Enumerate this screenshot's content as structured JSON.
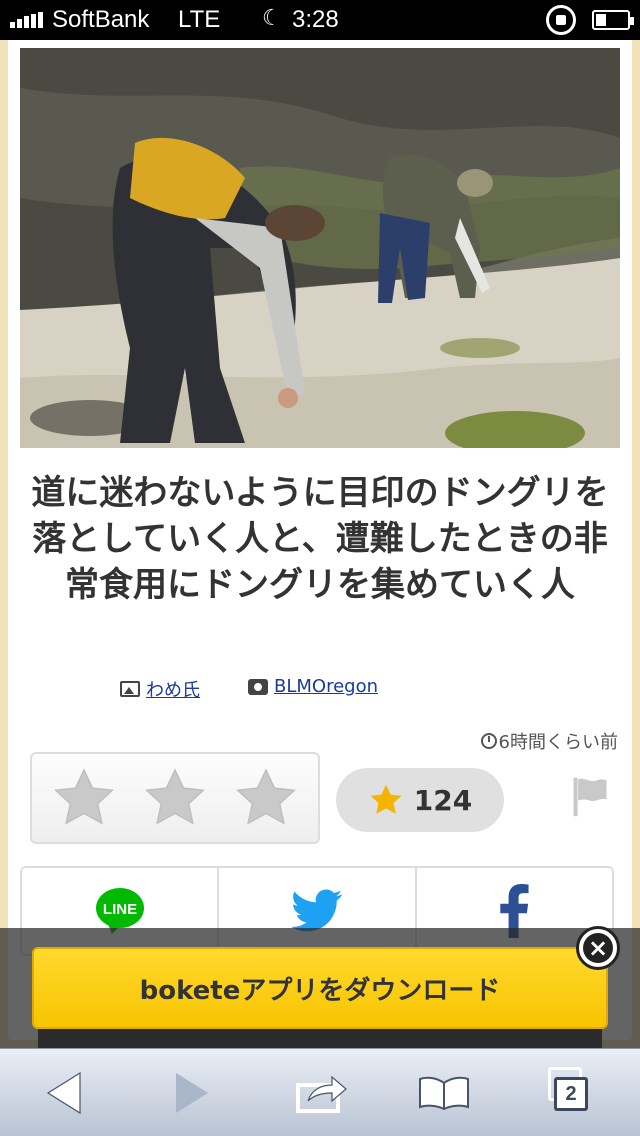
{
  "status_bar": {
    "carrier": "SoftBank",
    "network": "LTE",
    "time": "3:28"
  },
  "post": {
    "caption": "道に迷わないように目印のドングリを落としていく人と、遭難したときの非常食用にドングリを集めていく人",
    "author": "わめ氏",
    "photo_source": "BLMOregon",
    "posted_ago": "6時間くらい前",
    "star_count": "124"
  },
  "share": {
    "line_label": "LINE"
  },
  "banner": {
    "download_label": "boketeアプリをダウンロード"
  },
  "toolbar": {
    "tab_count": "2"
  },
  "colors": {
    "background": "#f3e2b8",
    "banner_yellow": "#f7c400",
    "star_gold": "#f4b400",
    "line_green": "#00b900",
    "twitter_blue": "#1da1f2",
    "facebook_blue": "#2d4f93",
    "link_blue": "#1a3b9e"
  },
  "icons": [
    "signal-icon",
    "moon-icon",
    "rotation-lock-icon",
    "battery-icon",
    "image-icon",
    "camera-icon",
    "clock-icon",
    "star-icon",
    "flag-icon",
    "line-icon",
    "twitter-icon",
    "facebook-icon",
    "close-icon",
    "back-icon",
    "forward-icon",
    "share-icon",
    "bookmarks-icon",
    "tabs-icon"
  ]
}
